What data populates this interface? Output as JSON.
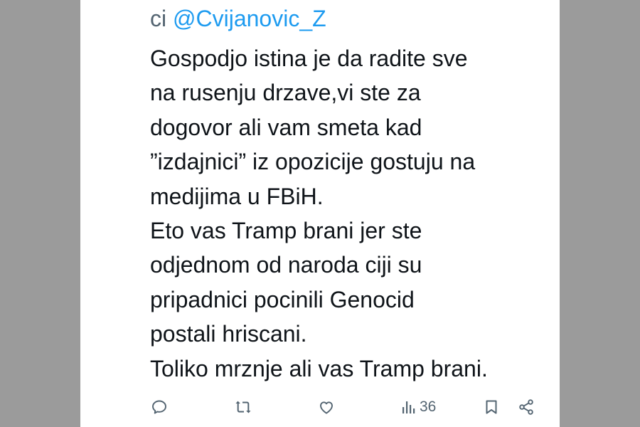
{
  "tweet": {
    "reply_prefix": "ci",
    "mention": "@Cvijanovic_Z",
    "lines": [
      "Gospodjo istina je da radite sve",
      "na rusenju drzave,vi ste za",
      "dogovor ali vam smeta kad",
      "”izdajnici” iz opozicije gostuju na",
      "medijima u FBiH.",
      "Eto vas Tramp brani jer ste",
      "odjednom od naroda ciji su",
      "pripadnici pocinili Genocid",
      "postali hriscani.",
      "Toliko mrznje ali vas Tramp brani."
    ]
  },
  "actions": {
    "reply_icon": "reply-icon",
    "retweet_icon": "retweet-icon",
    "like_icon": "like-icon",
    "views_icon": "views-icon",
    "views_count": "36",
    "bookmark_icon": "bookmark-icon",
    "share_icon": "share-icon"
  },
  "colors": {
    "mention": "#1d9bf0",
    "text": "#0f1419",
    "muted": "#536471",
    "side_bars": "#9b9b9b"
  }
}
